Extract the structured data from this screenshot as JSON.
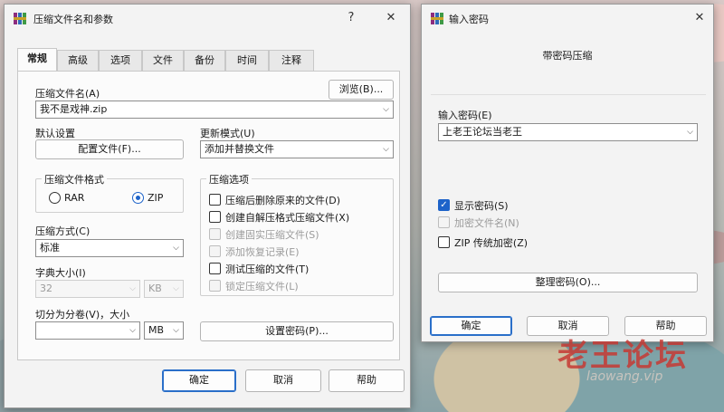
{
  "main_window": {
    "title": "压缩文件名和参数",
    "help_glyph": "?",
    "close_glyph": "✕",
    "tabs": [
      {
        "label": "常规"
      },
      {
        "label": "高级"
      },
      {
        "label": "选项"
      },
      {
        "label": "文件"
      },
      {
        "label": "备份"
      },
      {
        "label": "时间"
      },
      {
        "label": "注释"
      }
    ],
    "archive_name_label": "压缩文件名(A)",
    "browse_button": "浏览(B)...",
    "archive_name_value": "我不是戏神.zip",
    "default_settings_label": "默认设置",
    "profiles_button": "配置文件(F)...",
    "update_mode_label": "更新模式(U)",
    "update_mode_value": "添加并替换文件",
    "format_group_title": "压缩文件格式",
    "format_rar": "RAR",
    "format_zip": "ZIP",
    "format_selected": "ZIP",
    "options_group_title": "压缩选项",
    "options": [
      {
        "label": "压缩后删除原来的文件(D)",
        "checked": false,
        "enabled": true
      },
      {
        "label": "创建自解压格式压缩文件(X)",
        "checked": false,
        "enabled": true
      },
      {
        "label": "创建固实压缩文件(S)",
        "checked": false,
        "enabled": false
      },
      {
        "label": "添加恢复记录(E)",
        "checked": false,
        "enabled": false
      },
      {
        "label": "测试压缩的文件(T)",
        "checked": false,
        "enabled": true
      },
      {
        "label": "锁定压缩文件(L)",
        "checked": false,
        "enabled": false
      }
    ],
    "method_label": "压缩方式(C)",
    "method_value": "标准",
    "dict_label": "字典大小(I)",
    "dict_value": "32",
    "dict_unit": "KB",
    "split_label": "切分为分卷(V)，大小",
    "split_value": "",
    "split_unit": "MB",
    "set_password_button": "设置密码(P)...",
    "ok_button": "确定",
    "cancel_button": "取消",
    "help_button": "帮助"
  },
  "password_window": {
    "title": "输入密码",
    "close_glyph": "✕",
    "header": "带密码压缩",
    "password_label": "输入密码(E)",
    "password_value": "上老王论坛当老王",
    "show_password": "显示密码(S)",
    "show_password_checked": true,
    "encrypt_names": "加密文件名(N)",
    "encrypt_names_checked": false,
    "zip_legacy": "ZIP 传统加密(Z)",
    "zip_legacy_checked": false,
    "organize_button": "整理密码(O)...",
    "ok_button": "确定",
    "cancel_button": "取消",
    "help_button": "帮助"
  },
  "watermark": {
    "text": "老王论坛",
    "sub": "laowang.vip"
  },
  "colors": {
    "accent": "#1d63c9",
    "watermark": "#c63a34",
    "window_bg": "#f3f3f3"
  }
}
